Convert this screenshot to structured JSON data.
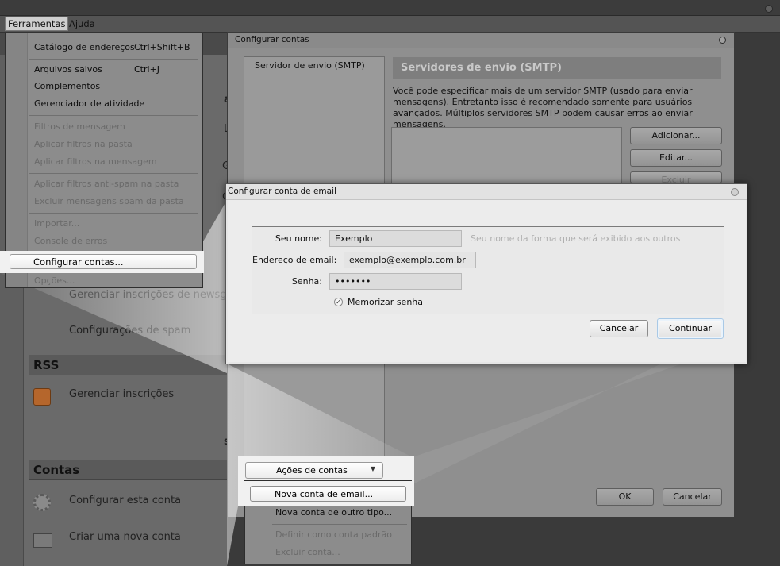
{
  "menubar": {
    "items": [
      "Ferramentas",
      "Ajuda"
    ]
  },
  "tools_menu": {
    "items": [
      {
        "label": "Catálogo de endereços",
        "shortcut": "Ctrl+Shift+B",
        "enabled": true
      },
      {
        "label": "Arquivos salvos",
        "shortcut": "Ctrl+J",
        "enabled": true
      },
      {
        "label": "Complementos",
        "shortcut": "",
        "enabled": true
      },
      {
        "label": "Gerenciador de atividade",
        "shortcut": "",
        "enabled": true
      },
      {
        "label": "Filtros de mensagem",
        "shortcut": "",
        "enabled": false
      },
      {
        "label": "Aplicar filtros na pasta",
        "shortcut": "",
        "enabled": false
      },
      {
        "label": "Aplicar filtros na mensagem",
        "shortcut": "",
        "enabled": false
      },
      {
        "label": "Aplicar filtros anti-spam na pasta",
        "shortcut": "",
        "enabled": false
      },
      {
        "label": "Excluir mensagens spam da pasta",
        "shortcut": "",
        "enabled": false
      },
      {
        "label": "Importar...",
        "shortcut": "",
        "enabled": false
      },
      {
        "label": "Console de erros",
        "shortcut": "",
        "enabled": false
      },
      {
        "label": "Configurar contas...",
        "shortcut": "",
        "enabled": true,
        "highlighted": true
      },
      {
        "label": "Opções...",
        "shortcut": "",
        "enabled": false
      }
    ]
  },
  "main_pane": {
    "partial_heading": "a",
    "partial_line_1": "La",
    "partial_line_2": "G",
    "partial_line_3": "G",
    "newsgroup_link": "Gerenciar inscrições de newsgr",
    "spam_link": "Configurações de spam",
    "rss_section": "RSS",
    "rss_link": "Gerenciar inscrições",
    "partial_s": "s",
    "contas_section": "Contas",
    "configure_account_link": "Configurar esta conta",
    "new_account_link": "Criar uma nova conta"
  },
  "accounts_window": {
    "title": "Configurar contas",
    "left_item": "Servidor de envio (SMTP)",
    "smtp_header": "Servidores de envio (SMTP)",
    "smtp_description": "Você pode especificar mais de um servidor SMTP (usado para enviar mensagens). Entretanto isso é recomendado somente para usuários avançados. Múltiplos servidores SMTP podem causar erros ao enviar mensagens.",
    "add_button": "Adicionar...",
    "edit_button": "Editar...",
    "delete_button": "Excluir",
    "ok_button": "OK",
    "cancel_button": "Cancelar",
    "account_actions_button": "Ações de contas",
    "account_actions_menu": [
      {
        "label": "Nova conta de email...",
        "enabled": true,
        "highlighted": true
      },
      {
        "label": "Nova conta de outro tipo...",
        "enabled": true
      },
      {
        "label": "Definir como conta padrão",
        "enabled": false
      },
      {
        "label": "Excluir conta...",
        "enabled": false
      }
    ]
  },
  "email_dialog": {
    "title": "Configurar conta de email",
    "name_label": "Seu nome:",
    "name_value": "Exemplo",
    "name_hint": "Seu nome da forma que será exibido aos outros",
    "email_label": "Endereço de email:",
    "email_value": "exemplo@exemplo.com.br",
    "password_label": "Senha:",
    "password_value": "•••••••",
    "remember_label": "Memorizar senha",
    "remember_checked": true,
    "cancel_button": "Cancelar",
    "continue_button": "Continuar"
  }
}
